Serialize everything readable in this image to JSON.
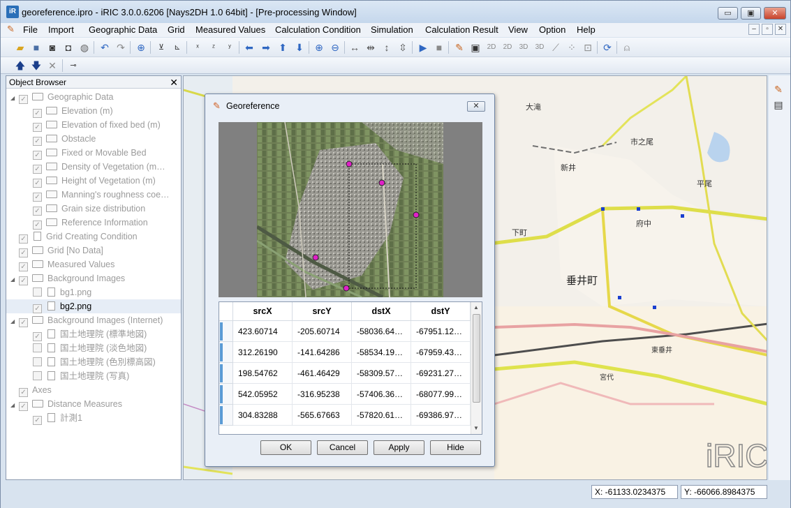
{
  "window": {
    "title": "georeference.ipro - iRIC 3.0.0.6206 [Nays2DH 1.0 64bit] - [Pre-processing Window]",
    "app_icon_text": "iR",
    "minimize_glyph": "▭",
    "maximize_glyph": "▣",
    "close_glyph": "✕"
  },
  "menubar": {
    "items": [
      "File",
      "Import",
      "Geographic Data",
      "Grid",
      "Measured Values",
      "Calculation Condition",
      "Simulation",
      "Calculation Result",
      "View",
      "Option",
      "Help"
    ],
    "mdi_minimize": "–",
    "mdi_restore": "▫",
    "mdi_close": "✕"
  },
  "toolbar": {
    "icons": [
      "open-folder-icon",
      "save-icon",
      "snapshot-icon",
      "snapshot-multi-icon",
      "globe-icon",
      "undo-icon",
      "redo-icon",
      "zoom-box-icon",
      "axis-yx-icon",
      "axis-reset-icon",
      "axis-x-icon",
      "axis-zy-icon",
      "axis-yz-icon",
      "arrow-left-icon",
      "arrow-right-icon",
      "arrow-up-icon",
      "arrow-down-icon",
      "zoom-in-icon",
      "zoom-out-icon",
      "fit-horizontal-icon",
      "shrink-horizontal-icon",
      "fit-vertical-icon",
      "shrink-vertical-icon",
      "run-icon",
      "stop-icon",
      "pencil-icon",
      "terminal-icon",
      "view-2d-icon",
      "view-2d-alt-icon",
      "view-3d-icon",
      "view-3d-alt-icon",
      "graph-icon",
      "scatter-icon",
      "cross-section-icon",
      "refresh-icon",
      "mouse-icon"
    ],
    "row2_icons": [
      "move-up-icon",
      "move-down-icon",
      "delete-icon",
      "pin-icon"
    ]
  },
  "object_browser": {
    "title": "Object Browser",
    "close_glyph": "✕",
    "items": [
      {
        "label": "Geographic Data",
        "level": 0,
        "expander": "◢",
        "checked": true,
        "type": "folder",
        "active": false
      },
      {
        "label": "Elevation (m)",
        "level": 1,
        "expander": "",
        "checked": true,
        "type": "folder",
        "active": false
      },
      {
        "label": "Elevation of fixed bed (m)",
        "level": 1,
        "expander": "",
        "checked": true,
        "type": "folder",
        "active": false
      },
      {
        "label": "Obstacle",
        "level": 1,
        "expander": "",
        "checked": true,
        "type": "folder",
        "active": false
      },
      {
        "label": "Fixed or Movable Bed",
        "level": 1,
        "expander": "",
        "checked": true,
        "type": "folder",
        "active": false
      },
      {
        "label": "Density of Vegetation (m…",
        "level": 1,
        "expander": "",
        "checked": true,
        "type": "folder",
        "active": false
      },
      {
        "label": "Height of Vegetation (m)",
        "level": 1,
        "expander": "",
        "checked": true,
        "type": "folder",
        "active": false
      },
      {
        "label": "Manning's roughness coe…",
        "level": 1,
        "expander": "",
        "checked": true,
        "type": "folder",
        "active": false
      },
      {
        "label": "Grain size distribution",
        "level": 1,
        "expander": "",
        "checked": true,
        "type": "folder",
        "active": false
      },
      {
        "label": "Reference Information",
        "level": 1,
        "expander": "",
        "checked": true,
        "type": "folder",
        "active": false
      },
      {
        "label": "Grid Creating Condition",
        "level": 0,
        "expander": "",
        "checked": true,
        "type": "file",
        "active": false
      },
      {
        "label": "Grid [No Data]",
        "level": 0,
        "expander": "",
        "checked": true,
        "type": "folder",
        "active": false
      },
      {
        "label": "Measured Values",
        "level": 0,
        "expander": "",
        "checked": true,
        "type": "folder",
        "active": false
      },
      {
        "label": "Background Images",
        "level": 0,
        "expander": "◢",
        "checked": true,
        "type": "folder",
        "active": false
      },
      {
        "label": "bg1.png",
        "level": 1,
        "expander": "",
        "checked": false,
        "type": "file",
        "active": false
      },
      {
        "label": "bg2.png",
        "level": 1,
        "expander": "",
        "checked": true,
        "type": "file",
        "active": true
      },
      {
        "label": "Background Images (Internet)",
        "level": 0,
        "expander": "◢",
        "checked": true,
        "type": "folder",
        "active": false
      },
      {
        "label": "国土地理院 (標準地図)",
        "level": 1,
        "expander": "",
        "checked": true,
        "type": "file",
        "active": false
      },
      {
        "label": "国土地理院 (淡色地図)",
        "level": 1,
        "expander": "",
        "checked": false,
        "type": "file",
        "active": false
      },
      {
        "label": "国土地理院 (色別標高図)",
        "level": 1,
        "expander": "",
        "checked": false,
        "type": "file",
        "active": false
      },
      {
        "label": "国土地理院 (写真)",
        "level": 1,
        "expander": "",
        "checked": false,
        "type": "file",
        "active": false
      },
      {
        "label": "Axes",
        "level": 0,
        "expander": "",
        "checked": true,
        "type": "none",
        "active": false
      },
      {
        "label": "Distance Measures",
        "level": 0,
        "expander": "◢",
        "checked": true,
        "type": "folder",
        "active": false
      },
      {
        "label": "計測1",
        "level": 1,
        "expander": "",
        "checked": true,
        "type": "file",
        "active": false
      }
    ]
  },
  "map": {
    "labels": [
      "大滝",
      "市之尾",
      "新井",
      "平尾",
      "下町",
      "府中",
      "垂井町",
      "東垂井",
      "宮代"
    ],
    "watermark": "iRIC"
  },
  "dialog": {
    "title": "Georeference",
    "close_glyph": "✕",
    "columns": [
      "srcX",
      "srcY",
      "dstX",
      "dstY"
    ],
    "rows": [
      [
        "423.60714",
        "-205.60714",
        "-58036.64…",
        "-67951.12…"
      ],
      [
        "312.26190",
        "-141.64286",
        "-58534.19…",
        "-67959.43…"
      ],
      [
        "198.54762",
        "-461.46429",
        "-58309.57…",
        "-69231.27…"
      ],
      [
        "542.05952",
        "-316.95238",
        "-57406.36…",
        "-68077.99…"
      ],
      [
        "304.83288",
        "-565.67663",
        "-57820.61…",
        "-69386.97…"
      ]
    ],
    "buttons": {
      "ok": "OK",
      "cancel": "Cancel",
      "apply": "Apply",
      "hide": "Hide"
    }
  },
  "status": {
    "x": "X: -61133.0234375",
    "y": "Y: -66066.8984375"
  }
}
